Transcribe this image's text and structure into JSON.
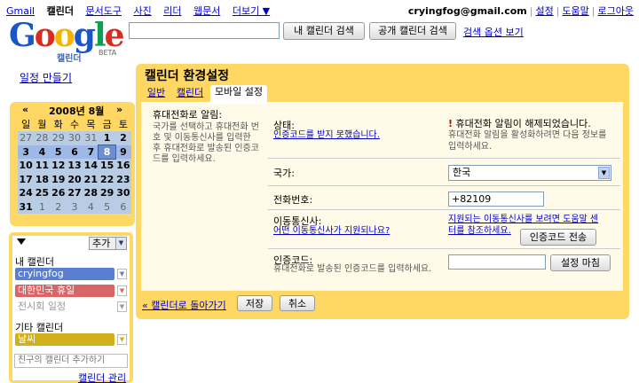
{
  "topnav": {
    "items": [
      "Gmail",
      "캘린더",
      "문서도구",
      "사진",
      "리더",
      "웹문서",
      "더보기 ▼"
    ],
    "active_index": 1
  },
  "user": {
    "email": "cryingfog@gmail.com",
    "links": [
      "설정",
      "도움말",
      "로그아웃"
    ]
  },
  "logo": {
    "text": "Google",
    "sub": "캘린더",
    "beta": "BETA"
  },
  "search": {
    "input_value": "",
    "mycal_button": "내 캘린더 검색",
    "public_button": "공개 캘린더 검색",
    "options_link": "검색 옵션 보기"
  },
  "sidebar": {
    "create_event": "일정 만들기",
    "minical": {
      "prev": "«",
      "next": "»",
      "title": "2008년 8월",
      "dow": [
        "일",
        "월",
        "화",
        "수",
        "목",
        "금",
        "토"
      ],
      "weeks": [
        [
          "27",
          "28",
          "29",
          "30",
          "31",
          "1",
          "2"
        ],
        [
          "3",
          "4",
          "5",
          "6",
          "7",
          "8",
          "9"
        ],
        [
          "10",
          "11",
          "12",
          "13",
          "14",
          "15",
          "16"
        ],
        [
          "17",
          "18",
          "19",
          "20",
          "21",
          "22",
          "23"
        ],
        [
          "24",
          "25",
          "26",
          "27",
          "28",
          "29",
          "30"
        ],
        [
          "31",
          "1",
          "2",
          "3",
          "4",
          "5",
          "6"
        ]
      ]
    },
    "calendars": {
      "add_button": "추가",
      "my_header": "내 캘린더",
      "my": [
        {
          "name": "cryingfog",
          "color": "#5a7fd1"
        },
        {
          "name": "대한민국 휴일",
          "color": "#d96666"
        },
        {
          "name": "전시회 일정",
          "color": "#ffffff"
        }
      ],
      "other_header": "기타 캘린더",
      "other": [
        {
          "name": "날씨",
          "color": "#d1b01c"
        }
      ],
      "add_friend_placeholder": "친구의 캘린더 추가하기",
      "manage_link": "캘린더 관리"
    }
  },
  "settings": {
    "title": "캘린더 환경설정",
    "tabs": [
      "일반",
      "캘린더",
      "모바일 설정"
    ],
    "active_tab": 2,
    "left_help": {
      "title": "휴대전화로 알림:",
      "text": "국가를 선택하고 휴대전화 번호 및 이동통신사를 입력한 후 휴대전화로 발송된 인증코드를 입력하세요."
    },
    "status": {
      "label": "상태:",
      "link": "인증코드를 받지 못했습니다.",
      "warn_title": "휴대전화 알림이 해제되었습니다.",
      "warn_text": "휴대전화 알림을 활성화하려면 다음 정보를 입력하세요."
    },
    "country": {
      "label": "국가:",
      "value": "한국"
    },
    "phone": {
      "label": "전화번호:",
      "value": "+82109"
    },
    "carrier": {
      "label": "이동통신사:",
      "link": "어떤 이동통신사가 지원되나요?",
      "help_link": "지원되는 이동통신사를 보려면 도움말 센터를 참조하세요.",
      "send_button": "인증코드 전송"
    },
    "code": {
      "label": "인증코드:",
      "hint": "휴대전화로 발송된 인증코드를 입력하세요.",
      "value": "",
      "finish_button": "설정 마침"
    },
    "footer": {
      "back_link": "« 캘린더로 돌아가기",
      "save": "저장",
      "cancel": "취소"
    }
  }
}
